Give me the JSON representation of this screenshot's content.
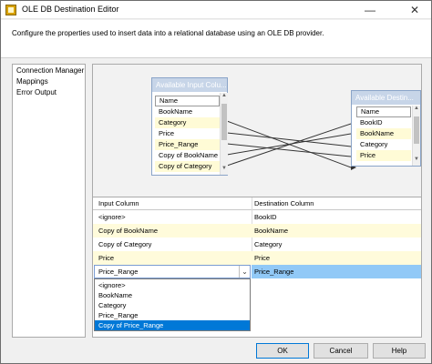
{
  "window": {
    "title": "OLE DB Destination Editor"
  },
  "title_buttons": {
    "minimize": "—",
    "close": "✕"
  },
  "description": "Configure the properties used to insert data into a relational database using an OLE DB provider.",
  "nav": {
    "items": [
      "Connection Manager",
      "Mappings",
      "Error Output"
    ]
  },
  "input_box": {
    "title": "Available Input Colu...",
    "header": "Name",
    "columns": [
      "BookName",
      "Category",
      "Price",
      "Price_Range",
      "Copy of BookName",
      "Copy of Category"
    ]
  },
  "dest_box": {
    "title": "Available Destin...",
    "header": "Name",
    "columns": [
      "BookID",
      "BookName",
      "Category",
      "Price"
    ]
  },
  "grid": {
    "headers": {
      "input": "Input Column",
      "destination": "Destination Column"
    },
    "rows": [
      {
        "input": "<ignore>",
        "destination": "BookID"
      },
      {
        "input": "Copy of BookName",
        "destination": "BookName"
      },
      {
        "input": "Copy of Category",
        "destination": "Category"
      },
      {
        "input": "Price",
        "destination": "Price"
      }
    ],
    "selected_row": {
      "input": "Price_Range",
      "destination": "Price_Range"
    }
  },
  "dropdown": {
    "options": [
      "<ignore>",
      "BookName",
      "Category",
      "Price_Range",
      "Copy of Price_Range"
    ],
    "selected": "Copy of Price_Range"
  },
  "buttons": {
    "ok": "OK",
    "cancel": "Cancel",
    "help": "Help"
  },
  "colors": {
    "accent": "#0078d7",
    "selection": "#91c9f7",
    "highlight_row": "#fffbdb"
  }
}
